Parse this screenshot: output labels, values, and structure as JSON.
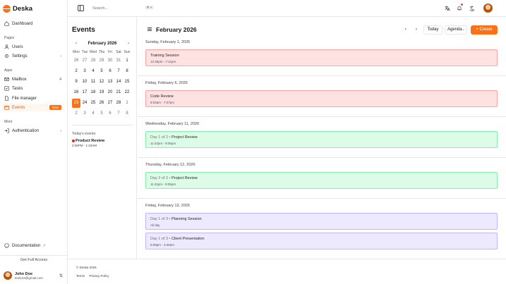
{
  "app": {
    "name": "Deska"
  },
  "search": {
    "placeholder": "Search...",
    "shortcut": "⌘ K"
  },
  "sidebar": {
    "section_pages": "Pages",
    "section_apps": "Apps",
    "section_more": "More",
    "items": [
      {
        "label": "Dashboard"
      },
      {
        "label": "Users"
      },
      {
        "label": "Settings",
        "right": "›"
      },
      {
        "label": "Mailbox",
        "right": "4"
      },
      {
        "label": "Tasks"
      },
      {
        "label": "File manager"
      },
      {
        "label": "Events",
        "badge": "New"
      },
      {
        "label": "Authentication",
        "right": "›"
      }
    ],
    "documentation": "Documentation",
    "documentation_ext": "↗",
    "full_access": "Get Full Access",
    "user": {
      "name": "John Doe",
      "email": "test123@gmail.com"
    }
  },
  "events_panel": {
    "title": "Events",
    "month_label": "February 2026",
    "prev": "‹",
    "next": "›",
    "weekdays": [
      "Mon",
      "Tue",
      "Wed",
      "Thu",
      "Fri",
      "Sat",
      "Sun"
    ],
    "days": [
      {
        "d": "26",
        "muted": true
      },
      {
        "d": "27",
        "muted": true
      },
      {
        "d": "28",
        "muted": true
      },
      {
        "d": "29",
        "muted": true
      },
      {
        "d": "30",
        "muted": true
      },
      {
        "d": "31",
        "muted": true
      },
      {
        "d": "1"
      },
      {
        "d": "2"
      },
      {
        "d": "3"
      },
      {
        "d": "4"
      },
      {
        "d": "5"
      },
      {
        "d": "6"
      },
      {
        "d": "7"
      },
      {
        "d": "8"
      },
      {
        "d": "9"
      },
      {
        "d": "10"
      },
      {
        "d": "11"
      },
      {
        "d": "12"
      },
      {
        "d": "13"
      },
      {
        "d": "14"
      },
      {
        "d": "15"
      },
      {
        "d": "16"
      },
      {
        "d": "17"
      },
      {
        "d": "18"
      },
      {
        "d": "19"
      },
      {
        "d": "20"
      },
      {
        "d": "21"
      },
      {
        "d": "22"
      },
      {
        "d": "23",
        "today": true
      },
      {
        "d": "24"
      },
      {
        "d": "25"
      },
      {
        "d": "26"
      },
      {
        "d": "27"
      },
      {
        "d": "28"
      },
      {
        "d": "1",
        "muted": true
      },
      {
        "d": "2",
        "muted": true
      },
      {
        "d": "3",
        "muted": true
      },
      {
        "d": "4",
        "muted": true
      },
      {
        "d": "5",
        "muted": true
      },
      {
        "d": "6",
        "muted": true
      },
      {
        "d": "7",
        "muted": true
      },
      {
        "d": "8",
        "muted": true
      }
    ],
    "today_label": "Today's events:",
    "today_event": {
      "title": "Product Review",
      "time": "3:36PM - 1:23AM"
    }
  },
  "agenda": {
    "month_title": "February 2026",
    "prev": "‹",
    "next": "›",
    "today_button": "Today",
    "view": "Agenda",
    "create_button": "+ Create",
    "days": [
      {
        "label": "Sunday, February 1, 2026",
        "events": [
          {
            "prefix": "",
            "title": "Training Session",
            "time": "12:45pm - 7:11pm",
            "color": "red"
          }
        ]
      },
      {
        "label": "Friday, February 6, 2026",
        "events": [
          {
            "prefix": "",
            "title": "Code Review",
            "time": "8:03am - 7:07pm",
            "color": "red"
          }
        ]
      },
      {
        "label": "Wednesday, February 11, 2026",
        "events": [
          {
            "prefix": "Day 1 of 2 • ",
            "title": "Project Review",
            "time": "11:42pm - 9:05pm",
            "color": "green"
          }
        ]
      },
      {
        "label": "Thursday, February 12, 2026",
        "events": [
          {
            "prefix": "Day 2 of 2 • ",
            "title": "Project Review",
            "time": "11:42pm - 9:05pm",
            "color": "green"
          }
        ]
      },
      {
        "label": "Friday, February 13, 2026",
        "events": [
          {
            "prefix": "Day 1 of 3 • ",
            "title": "Planning Session",
            "time": "All day",
            "color": "purple"
          },
          {
            "prefix": "Day 1 of 3 • ",
            "title": "Client Presentation",
            "time": "5:09pm - 3:46am",
            "color": "purple"
          }
        ]
      }
    ]
  },
  "footer": {
    "copyright": "© Deska 2026",
    "links": [
      "Terms",
      "Privacy Policy"
    ]
  },
  "colors": {
    "accent": "#f97316",
    "event_red": "#fee2e2",
    "event_green": "#dcfce7",
    "event_purple": "#ede9fe"
  }
}
